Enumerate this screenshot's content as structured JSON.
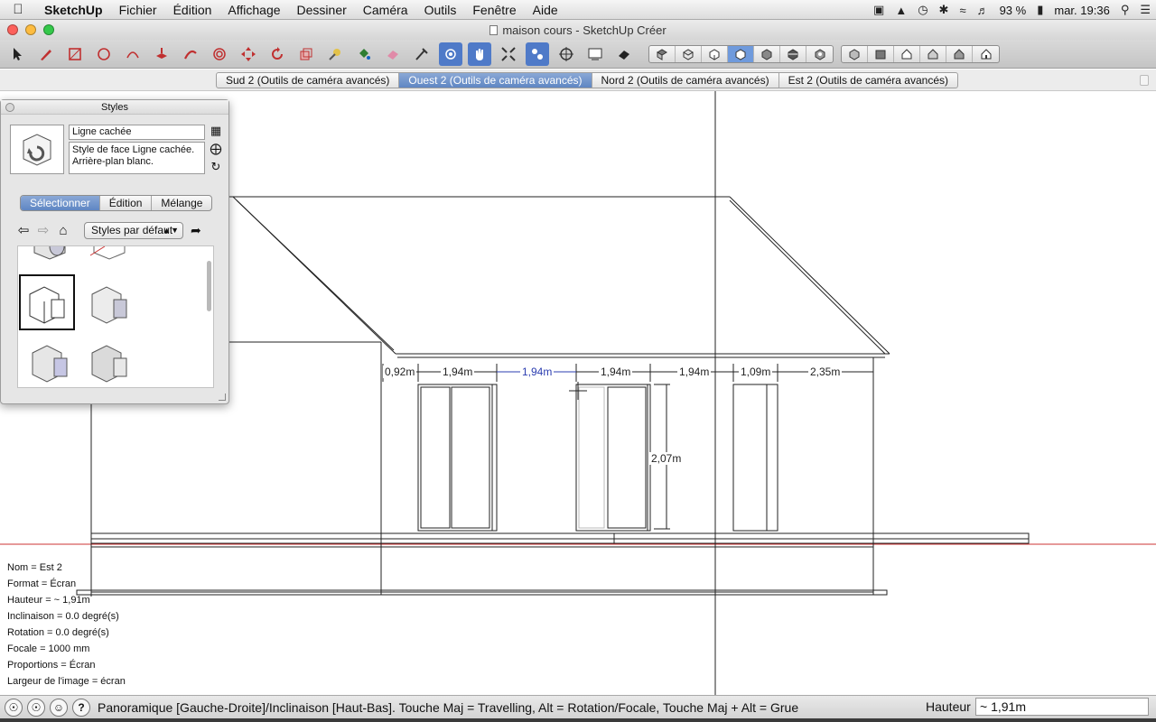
{
  "menubar": {
    "app_name": "SketchUp",
    "items": [
      "Fichier",
      "Édition",
      "Affichage",
      "Dessiner",
      "Caméra",
      "Outils",
      "Fenêtre",
      "Aide"
    ],
    "battery": "93 %",
    "clock": "mar. 19:36",
    "status_icons": [
      "camera-icon",
      "drive-icon",
      "time-machine-icon",
      "bluetooth-icon",
      "wifi-icon",
      "volume-icon",
      "battery-icon",
      "spotlight-icon",
      "list-icon"
    ]
  },
  "window": {
    "title": "maison cours - SketchUp Créer"
  },
  "scene_tabs": [
    {
      "label": "Sud 2 (Outils de caméra avancés)",
      "active": false
    },
    {
      "label": "Ouest 2 (Outils de caméra avancés)",
      "active": true
    },
    {
      "label": "Nord 2 (Outils de caméra avancés)",
      "active": false
    },
    {
      "label": "Est 2 (Outils de caméra avancés)",
      "active": false
    }
  ],
  "dimensions": {
    "d1": "0,92m",
    "d2": "1,94m",
    "d3": "1,94m",
    "d4": "1,94m",
    "d5": "1,94m",
    "d6": "1,09m",
    "d7": "2,35m",
    "height": "2,07m"
  },
  "camera_info": {
    "nom": "Nom = Est 2",
    "format": "Format = Écran",
    "hauteur": "Hauteur = ~ 1,91m",
    "inclinaison": "Inclinaison = 0.0 degré(s)",
    "rotation": "Rotation = 0.0 degré(s)",
    "focale": "Focale = 1000 mm",
    "proportions": "Proportions = Écran",
    "largeur": "Largeur de l'image = écran"
  },
  "styles_panel": {
    "title": "Styles",
    "style_name": "Ligne cachée",
    "description": "Style de face Ligne cachée. Arrière-plan blanc.",
    "tabs": [
      {
        "label": "Sélectionner",
        "active": true
      },
      {
        "label": "Édition",
        "active": false
      },
      {
        "label": "Mélange",
        "active": false
      }
    ],
    "collection_dropdown": "Styles par défaut"
  },
  "statusbar": {
    "message": "Panoramique [Gauche-Droite]/Inclinaison [Haut-Bas]. Touche Maj = Travelling, Alt = Rotation/Focale, Touche Maj + Alt = Grue",
    "vcb_label": "Hauteur",
    "vcb_value": "~ 1,91m"
  },
  "colors": {
    "accent_blue": "#5f86c3",
    "axis_red": "#cc3333",
    "selected_dimension": "#2b3db0"
  }
}
